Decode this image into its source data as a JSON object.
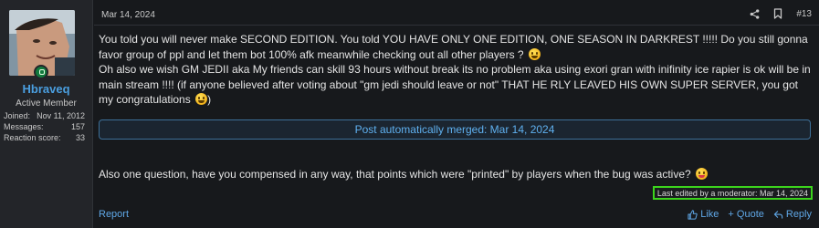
{
  "user": {
    "name": "Hbraveq",
    "title": "Active Member",
    "stats": [
      {
        "label": "Joined:",
        "value": "Nov 11, 2012"
      },
      {
        "label": "Messages:",
        "value": "157"
      },
      {
        "label": "Reaction score:",
        "value": "33"
      }
    ]
  },
  "post": {
    "date": "Mar 14, 2024",
    "number": "#13",
    "paragraph1": "You told you will never make SECOND EDITION. You told YOU HAVE ONLY ONE EDITION, ONE SEASON IN DARKREST !!!!! Do you still gonna favor group of ppl and let them bot 100% afk meanwhile checking out all other players ?",
    "paragraph2": "Oh also we wish GM JEDII aka My friends can skill 93 hours without break its no problem aka using exori gran with inifinity ice rapier is ok will be in main stream !!!! (if anyone believed after voting about \"gm jedi should leave or not\" THAT HE RLY LEAVED HIS OWN SUPER SERVER, you got my congratulations",
    "paragraph2_tail": ")",
    "merged_label": "Post automatically merged: Mar 14, 2024",
    "paragraph3": "Also one question, have you compensed in any way, that points which were \"printed\" by players when the bug was active?",
    "edited": "Last edited by a moderator: Mar 14, 2024"
  },
  "footer": {
    "report": "Report",
    "like": "Like",
    "quote": "+ Quote",
    "reply": "Reply"
  },
  "icons": {
    "share": "share-icon",
    "bookmark": "bookmark-icon",
    "like": "thumbs-up-icon",
    "reply": "reply-icon",
    "online": "online-status-icon"
  },
  "colors": {
    "accent": "#5fa7e6",
    "username": "#4a9fe0",
    "highlight": "#3cd41d",
    "online": "#127a3d"
  }
}
